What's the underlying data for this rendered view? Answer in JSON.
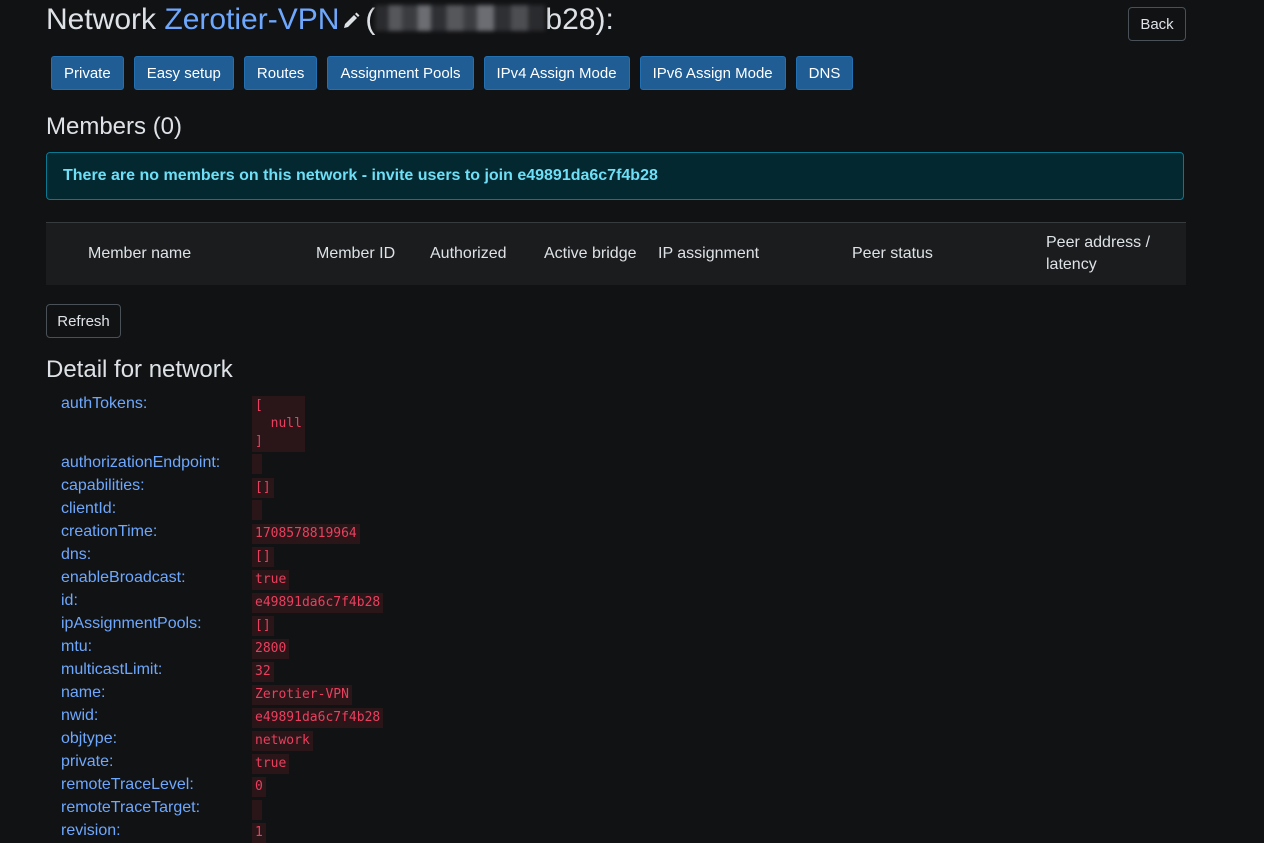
{
  "header": {
    "title_prefix": "Network",
    "network_name": "Zerotier-VPN",
    "id_open": "(",
    "id_visible_suffix": "b28):",
    "back_label": "Back"
  },
  "toolbar": {
    "buttons": [
      "Private",
      "Easy setup",
      "Routes",
      "Assignment Pools",
      "IPv4 Assign Mode",
      "IPv6 Assign Mode",
      "DNS"
    ]
  },
  "members": {
    "heading": "Members (0)",
    "alert": "There are no members on this network - invite users to join e49891da6c7f4b28",
    "columns": [
      "Member name",
      "Member ID",
      "Authorized",
      "Active bridge",
      "IP assignment",
      "Peer status",
      "Peer address / latency"
    ],
    "refresh_label": "Refresh"
  },
  "detail": {
    "heading": "Detail for network",
    "fields": [
      {
        "key": "authTokens:",
        "value": "[\n  null\n]"
      },
      {
        "key": "authorizationEndpoint:",
        "value": ""
      },
      {
        "key": "capabilities:",
        "value": "[]"
      },
      {
        "key": "clientId:",
        "value": ""
      },
      {
        "key": "creationTime:",
        "value": "1708578819964"
      },
      {
        "key": "dns:",
        "value": "[]"
      },
      {
        "key": "enableBroadcast:",
        "value": "true"
      },
      {
        "key": "id:",
        "value": "e49891da6c7f4b28"
      },
      {
        "key": "ipAssignmentPools:",
        "value": "[]"
      },
      {
        "key": "mtu:",
        "value": "2800"
      },
      {
        "key": "multicastLimit:",
        "value": "32"
      },
      {
        "key": "name:",
        "value": "Zerotier-VPN"
      },
      {
        "key": "nwid:",
        "value": "e49891da6c7f4b28"
      },
      {
        "key": "objtype:",
        "value": "network"
      },
      {
        "key": "private:",
        "value": "true"
      },
      {
        "key": "remoteTraceLevel:",
        "value": "0"
      },
      {
        "key": "remoteTraceTarget:",
        "value": ""
      },
      {
        "key": "revision:",
        "value": "1"
      }
    ]
  },
  "icons": {
    "edit": "pencil-icon"
  },
  "colors": {
    "accent": "#6ea8fe",
    "button": "#1f5d94",
    "code": "#e8405e"
  }
}
